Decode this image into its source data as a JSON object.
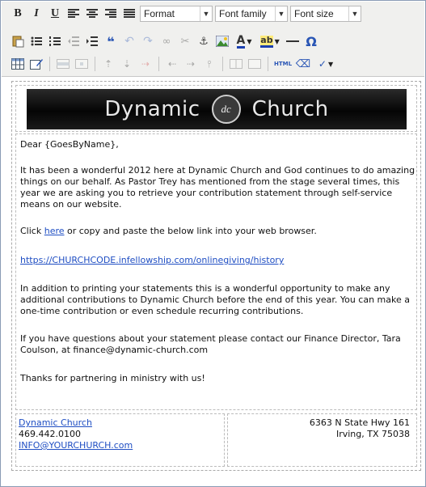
{
  "toolbar": {
    "format_label": "Format",
    "font_family_label": "Font family",
    "font_size_label": "Font size",
    "bold": "B",
    "italic": "I",
    "underline": "U",
    "html_label": "HTML",
    "omega": "Ω",
    "font_color_letter": "A"
  },
  "banner": {
    "left_word": "Dynamic",
    "logo_text": "dc",
    "right_word": "Church"
  },
  "letter": {
    "greeting": "Dear {GoesByName},",
    "p1": "It has been a wonderful 2012 here at Dynamic Church and God continues to do amazing things on our behalf. As Pastor Trey has mentioned from the stage several times, this year we are asking you to retrieve your contribution statement through self-service means on our website.",
    "p2_before": "Click ",
    "p2_link": "here",
    "p2_after": " or copy and paste the below link into your web browser.",
    "url": "https://CHURCHCODE.infellowship.com/onlinegiving/history",
    "p3": "In addition to printing your statements this is a wonderful opportunity to make any additional contributions to Dynamic Church before the end of this year. You can make a one-time contribution or even schedule recurring contributions.",
    "p4": "If you have questions about your statement please contact our Finance Director, Tara Coulson, at finance@dynamic-church.com",
    "p5": "Thanks for partnering in ministry with us!"
  },
  "footer": {
    "church_name": "Dynamic Church",
    "phone": "469.442.0100",
    "email": "INFO@YOURCHURCH.com",
    "address_line1": "6363 N State Hwy 161",
    "address_line2": "Irving, TX 75038"
  },
  "colors": {
    "link": "#1f4ec3",
    "toolbar_bg": "#f0f0ee"
  }
}
